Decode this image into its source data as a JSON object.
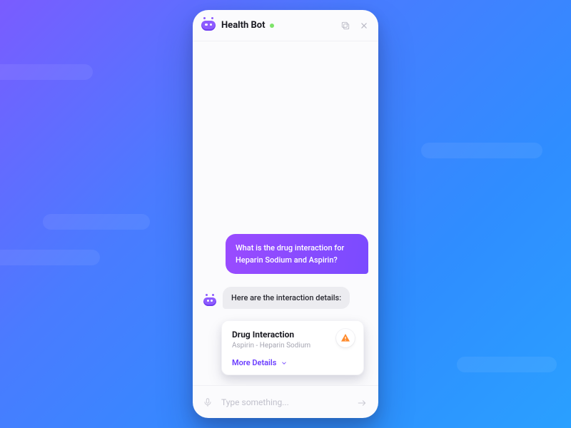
{
  "header": {
    "title": "Health Bot",
    "status": "online"
  },
  "messages": {
    "user_0": "What is the drug interaction for Heparin Sodium and Aspirin?",
    "bot_0": "Here are the interaction details:"
  },
  "card": {
    "title": "Drug Interaction",
    "subtitle": "Aspirin - Heparin Sodium",
    "link_label": "More Details",
    "severity_icon": "warning-triangle",
    "accent_color": "#ff8a2b"
  },
  "input": {
    "placeholder": "Type something...",
    "value": ""
  },
  "icons": {
    "bot_avatar": "robot-face",
    "copy": "stacked-squares",
    "close": "x",
    "mic": "microphone",
    "send": "arrow-right",
    "chevron_down": "chevron-down"
  },
  "colors": {
    "brand_purple": "#8e5cff",
    "user_bubble_start": "#9a4bff",
    "user_bubble_end": "#7a4bff",
    "link": "#6a3cff",
    "status_online": "#7de36a"
  }
}
